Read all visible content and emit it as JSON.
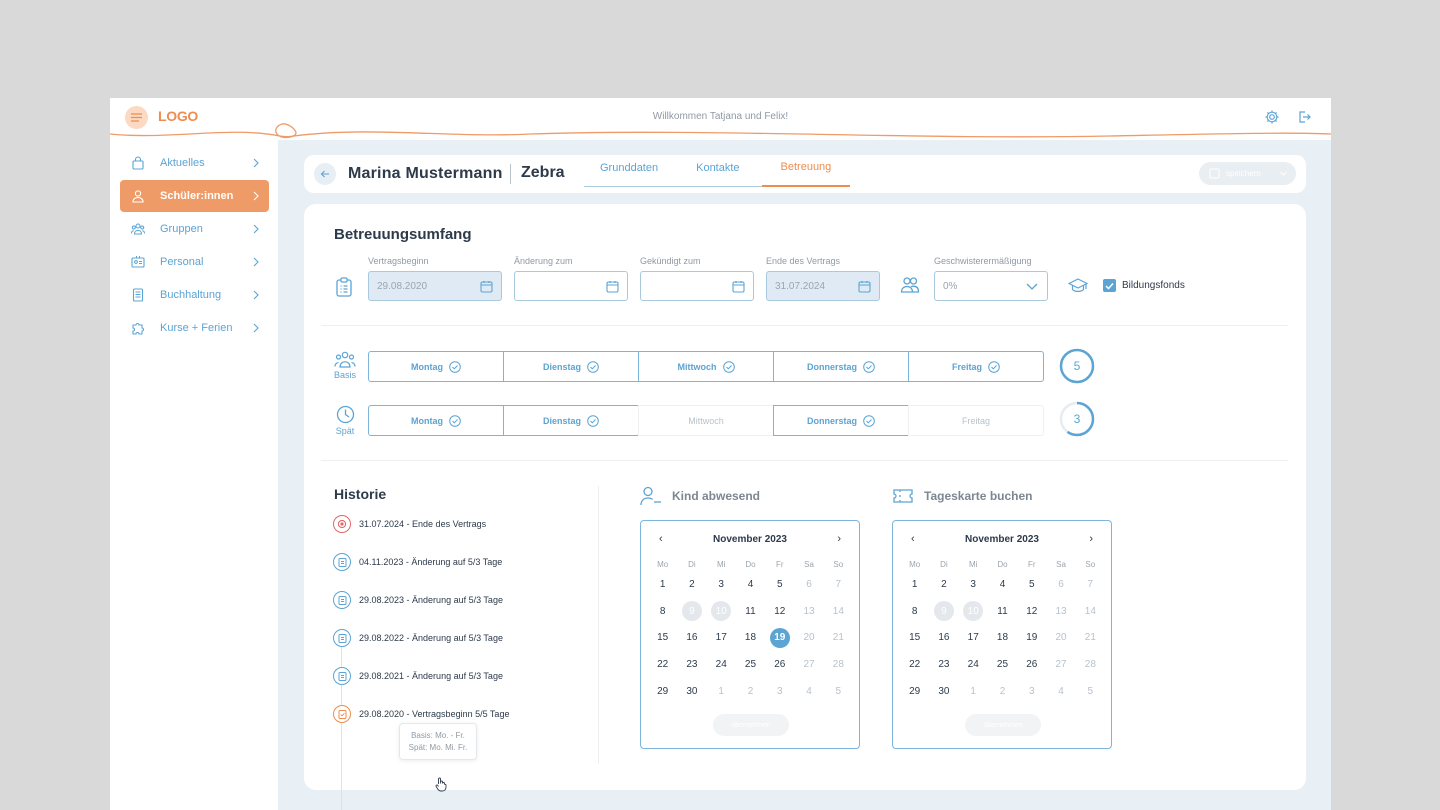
{
  "topbar": {
    "logo": "LOGO",
    "welcome": "Willkommen Tatjana und Felix!"
  },
  "sidebar": {
    "items": [
      {
        "label": "Aktuelles",
        "icon": "bag-icon"
      },
      {
        "label": "Schüler:innen",
        "icon": "person-icon",
        "active": true
      },
      {
        "label": "Gruppen",
        "icon": "group-icon"
      },
      {
        "label": "Personal",
        "icon": "id-card-icon"
      },
      {
        "label": "Buchhaltung",
        "icon": "ledger-icon"
      },
      {
        "label": "Kurse + Ferien",
        "icon": "puzzle-icon"
      }
    ]
  },
  "header": {
    "first_name": "Marina",
    "last_name": "Mustermann",
    "group": "Zebra",
    "tabs": [
      "Grunddaten",
      "Kontakte",
      "Betreuung"
    ],
    "active_tab": "Betreuung",
    "save_label": "speichern"
  },
  "betreuung": {
    "title": "Betreuungsumfang",
    "fields": {
      "vertragsbeginn": {
        "label": "Vertragsbeginn",
        "value": "29.08.2020"
      },
      "aenderung": {
        "label": "Änderung zum",
        "value": ""
      },
      "gekuendigt": {
        "label": "Gekündigt zum",
        "value": ""
      },
      "ende": {
        "label": "Ende des Vertrags",
        "value": "31.07.2024"
      },
      "geschwister": {
        "label": "Geschwisterermäßigung",
        "value": "0%"
      }
    },
    "bildungsfonds": {
      "label": "Bildungsfonds",
      "checked": true
    },
    "rows": [
      {
        "label": "Basis",
        "days": [
          {
            "name": "Montag",
            "on": true
          },
          {
            "name": "Dienstag",
            "on": true
          },
          {
            "name": "Mittwoch",
            "on": true
          },
          {
            "name": "Donnerstag",
            "on": true
          },
          {
            "name": "Freitag",
            "on": true
          }
        ],
        "count": "5"
      },
      {
        "label": "Spät",
        "days": [
          {
            "name": "Montag",
            "on": true
          },
          {
            "name": "Dienstag",
            "on": true
          },
          {
            "name": "Mittwoch",
            "on": false
          },
          {
            "name": "Donnerstag",
            "on": true
          },
          {
            "name": "Freitag",
            "on": false
          }
        ],
        "count": "3"
      }
    ]
  },
  "historie": {
    "title": "Historie",
    "items": [
      "31.07.2024 - Ende des Vertrags",
      "04.11.2023 - Änderung auf 5/3 Tage",
      "29.08.2023 - Änderung auf 5/3 Tage",
      "29.08.2022 - Änderung auf 5/3 Tage",
      "29.08.2021 - Änderung auf 5/3 Tage",
      "29.08.2020 - Vertragsbeginn 5/5 Tage"
    ],
    "tooltip": {
      "line1": "Basis: Mo. - Fr.",
      "line2": "Spät: Mo. Mi. Fr."
    }
  },
  "calendars": [
    {
      "title": "Kind abwesend",
      "month": "November 2023",
      "button": "übernehmen",
      "selected": "19"
    },
    {
      "title": "Tageskarte buchen",
      "month": "November 2023",
      "button": "übernehmen",
      "selected": ""
    }
  ],
  "weekdays": [
    "Mo",
    "Di",
    "Mi",
    "Do",
    "Fr",
    "Sa",
    "So"
  ],
  "colors": {
    "accent_orange": "#ef8d4f",
    "accent_blue": "#5ba4d4",
    "background": "#e9f0f5"
  }
}
